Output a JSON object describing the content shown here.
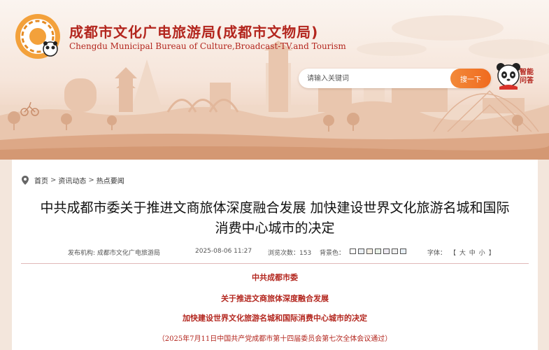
{
  "header": {
    "title": "成都市文化广电旅游局(成都市文物局)",
    "subtitle": "Chengdu Municipal Bureau of Culture,Broadcast-TV.and Tourism",
    "search_placeholder": "请输入关键词",
    "search_button": "搜一下",
    "assistant_label": "智能问答"
  },
  "breadcrumb": {
    "items": [
      "首页",
      "资讯动态",
      "热点要闻"
    ],
    "separator": ">"
  },
  "article": {
    "title": "中共成都市委关于推进文商旅体深度融合发展 加快建设世界文化旅游名城和国际消费中心城市的决定",
    "meta": {
      "publisher": "发布机构: 成都市文化广电旅游局",
      "date": "2025-08-06 11:27",
      "views": "浏览次数：153",
      "bg_color_label": "背景色：",
      "font_label": "字体：",
      "font_open": "【",
      "font_large": "大",
      "font_medium": "中",
      "font_small": "小",
      "font_close": "】"
    },
    "background_swatches": [
      "#ffffff",
      "#e9eef3",
      "#f5efe3",
      "#e8f1e6",
      "#eeeaf2",
      "#f0f0f0",
      "#e6eef5"
    ],
    "body": {
      "line1": "中共成都市委",
      "line2": "关于推进文商旅体深度融合发展",
      "line3": "加快建设世界文化旅游名城和国际消费中心城市的决定",
      "line4": "（2025年7月11日中国共产党成都市第十四届委员会第七次全体会议通过）"
    }
  },
  "colors": {
    "brand_red": "#b3261e",
    "search_orange": "#f06a1e",
    "divider": "#e0b8b8"
  }
}
